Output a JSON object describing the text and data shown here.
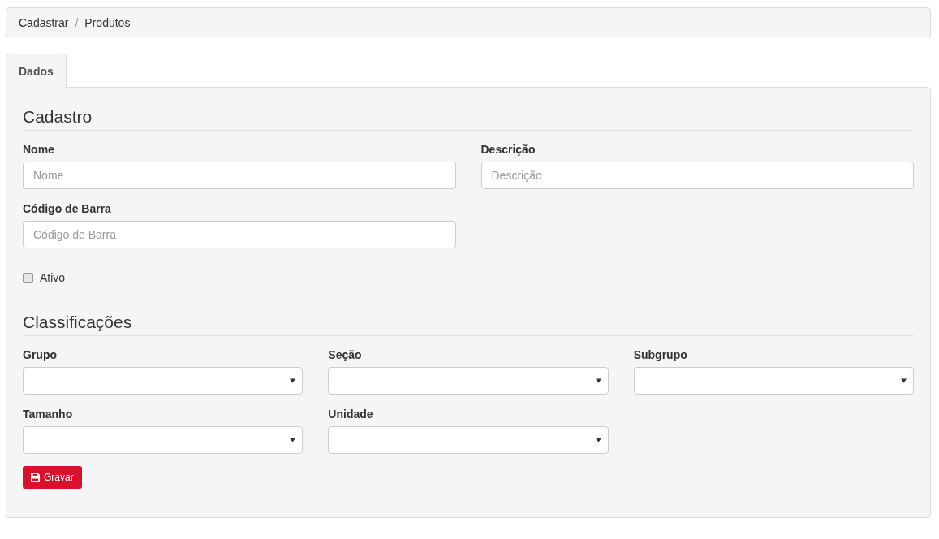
{
  "breadcrumb": [
    {
      "label": "Cadastrar"
    },
    {
      "separator": "/",
      "label": "Produtos"
    }
  ],
  "tabs": [
    {
      "label": "Dados",
      "selected": true
    }
  ],
  "sections": [
    {
      "title": "Cadastro",
      "kind": "details",
      "fields": [
        {
          "kind": "text",
          "label": "Nome",
          "placeholder": "Nome"
        },
        {
          "kind": "text",
          "label": "Descrição",
          "placeholder": "Descrição"
        },
        {
          "kind": "text",
          "label": "Código de Barra",
          "placeholder": "Código de Barra"
        },
        {
          "kind": "checkbox",
          "label": "Ativo",
          "checked": false
        }
      ]
    },
    {
      "title": "Classificações",
      "kind": "classification",
      "fields": [
        {
          "kind": "select",
          "label": "Grupo"
        },
        {
          "kind": "select",
          "label": "Seção"
        },
        {
          "kind": "select",
          "label": "Subgrupo"
        },
        {
          "kind": "select",
          "label": "Tamanho"
        },
        {
          "kind": "select",
          "label": "Unidade"
        }
      ]
    }
  ],
  "save_button": {
    "label": "Gravar"
  }
}
